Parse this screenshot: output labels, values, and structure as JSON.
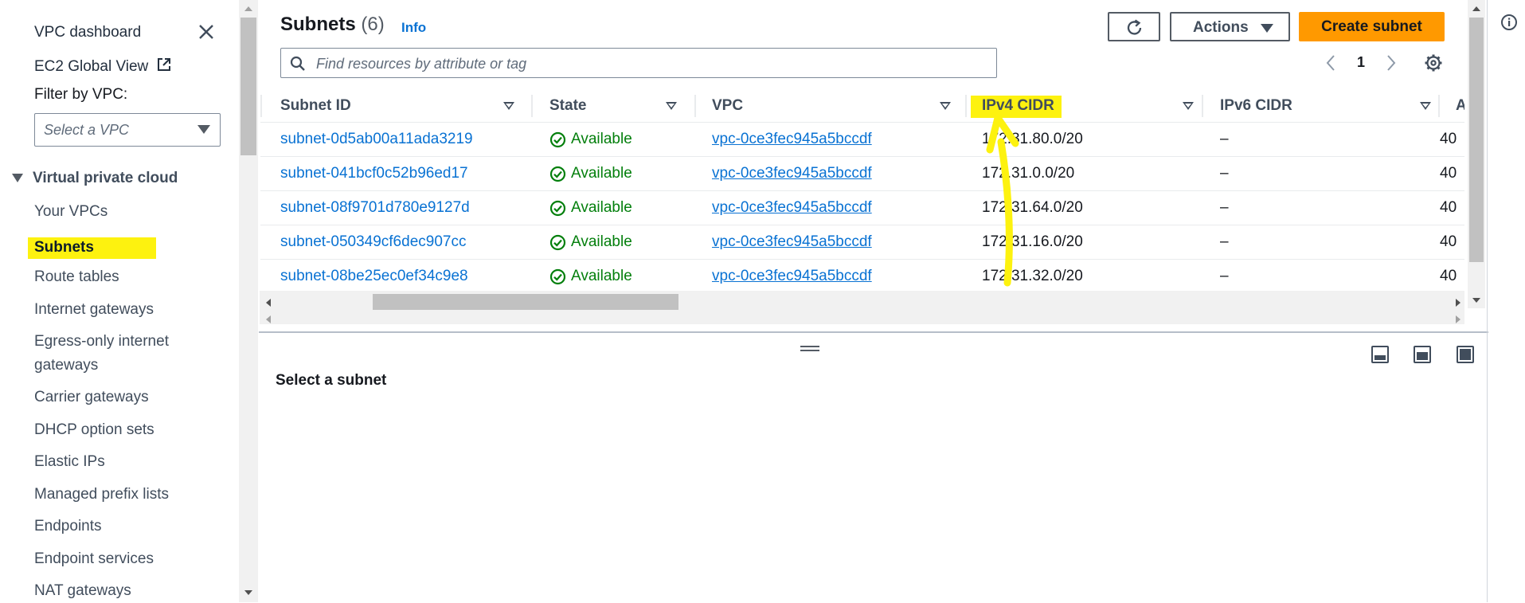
{
  "sidebar": {
    "vpc_dashboard": "VPC dashboard",
    "ec2_global_view": "EC2 Global View",
    "filter_label": "Filter by VPC:",
    "filter_placeholder": "Select a VPC",
    "section_title": "Virtual private cloud",
    "items": [
      {
        "label": "Your VPCs"
      },
      {
        "label": "Subnets"
      },
      {
        "label": "Route tables"
      },
      {
        "label": "Internet gateways"
      },
      {
        "label": "Egress-only internet"
      },
      {
        "label": "gateways"
      },
      {
        "label": "Carrier gateways"
      },
      {
        "label": "DHCP option sets"
      },
      {
        "label": "Elastic IPs"
      },
      {
        "label": "Managed prefix lists"
      },
      {
        "label": "Endpoints"
      },
      {
        "label": "Endpoint services"
      },
      {
        "label": "NAT gateways"
      }
    ]
  },
  "header": {
    "title": "Subnets",
    "count": "(6)",
    "info": "Info",
    "actions": "Actions",
    "create": "Create subnet"
  },
  "search": {
    "placeholder": "Find resources by attribute or tag"
  },
  "pagination": {
    "page": "1"
  },
  "table": {
    "columns": [
      "Subnet ID",
      "State",
      "VPC",
      "IPv4 CIDR",
      "IPv6 CIDR",
      "Av"
    ],
    "rows": [
      {
        "id": "subnet-0d5ab00a11ada3219",
        "state": "Available",
        "vpc": "vpc-0ce3fec945a5bccdf",
        "ipv4": "172.31.80.0/20",
        "ipv6": "–",
        "az": "40"
      },
      {
        "id": "subnet-041bcf0c52b96ed17",
        "state": "Available",
        "vpc": "vpc-0ce3fec945a5bccdf",
        "ipv4": "172.31.0.0/20",
        "ipv6": "–",
        "az": "40"
      },
      {
        "id": "subnet-08f9701d780e9127d",
        "state": "Available",
        "vpc": "vpc-0ce3fec945a5bccdf",
        "ipv4": "172.31.64.0/20",
        "ipv6": "–",
        "az": "40"
      },
      {
        "id": "subnet-050349cf6dec907cc",
        "state": "Available",
        "vpc": "vpc-0ce3fec945a5bccdf",
        "ipv4": "172.31.16.0/20",
        "ipv6": "–",
        "az": "40"
      },
      {
        "id": "subnet-08be25ec0ef34c9e8",
        "state": "Available",
        "vpc": "vpc-0ce3fec945a5bccdf",
        "ipv4": "172.31.32.0/20",
        "ipv6": "–",
        "az": "40"
      }
    ]
  },
  "detail": {
    "title": "Select a subnet"
  },
  "colors": {
    "link": "#0972d3",
    "success": "#037f0c",
    "primary_button": "#ff9900",
    "highlight": "#fdf20f"
  },
  "icons": [
    "close-icon",
    "external-link-icon",
    "refresh-icon",
    "search-icon",
    "chevron-left-icon",
    "chevron-right-icon",
    "gear-icon",
    "status-success-icon",
    "info-icon"
  ]
}
